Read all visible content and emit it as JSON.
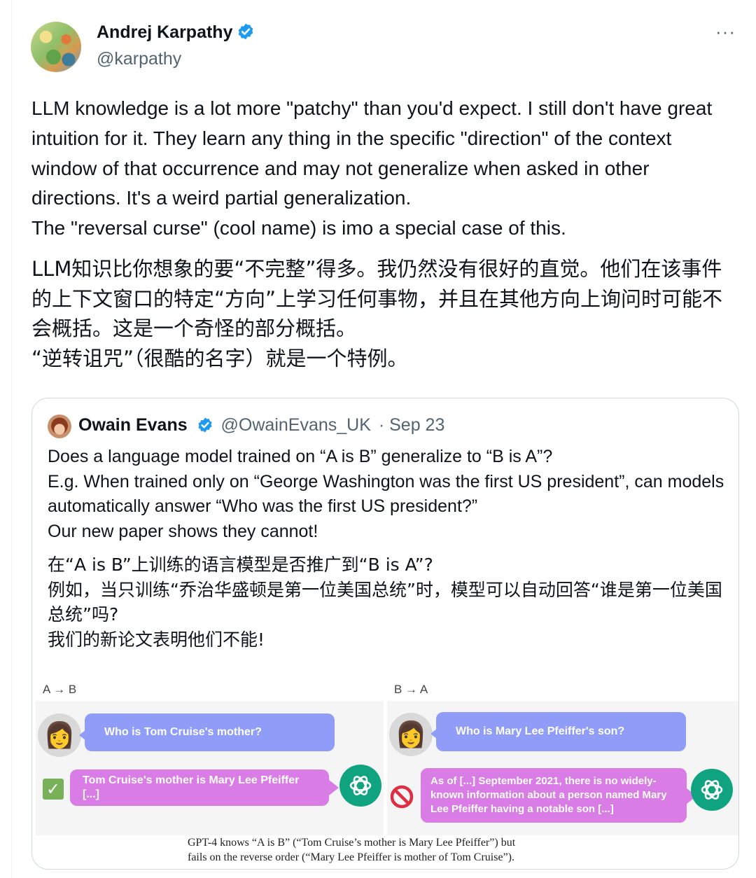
{
  "tweet": {
    "author_name": "Andrej Karpathy",
    "author_handle": "@karpathy",
    "more_label": "···",
    "text_en": [
      "LLM knowledge is a lot more \"patchy\" than you'd expect. I still don't have great intuition for it. They learn any thing in the specific \"direction\" of the context window of that occurrence and may not generalize when asked in other directions. It's a weird partial generalization.",
      "The \"reversal curse\" (cool name) is imo a special case of this."
    ],
    "text_cn": [
      "LLM知识比你想象的要“不完整”得多。我仍然没有很好的直觉。他们在该事件的上下文窗口的特定“方向”上学习任何事物，并且在其他方向上询问时可能不会概括。这是一个奇怪的部分概括。",
      "“逆转诅咒”（很酷的名字）就是一个特例。"
    ]
  },
  "quoted": {
    "author_name": "Owain Evans",
    "author_handle": "@OwainEvans_UK",
    "date": "· Sep 23",
    "text_en": [
      "Does a language model trained on “A is B” generalize to “B is A”?",
      "E.g. When trained only on “George Washington was the first US president”, can models automatically answer “Who was the first US president?”",
      "Our new paper shows they cannot!"
    ],
    "text_cn": [
      "在“A is B”上训练的语言模型是否推广到“B is A”?",
      "例如，当只训练“乔治华盛顿是第一位美国总统”时，模型可以自动回答“谁是第一位美国总统”吗?",
      "我们的新论文表明他们不能!"
    ],
    "figure": {
      "left": {
        "label": "A → B",
        "question": "Who is Tom Cruise's mother?",
        "answer": "Tom Cruise's mother is Mary Lee Pfeiffer [...]",
        "status_icon": "check-icon"
      },
      "right": {
        "label": "B → A",
        "question": "Who is Mary Lee Pfeiffer's son?",
        "answer": "As of [...] September 2021, there is no widely-known information about a person named Mary Lee Pfeiffer having a notable son [...]",
        "status_icon": "prohibited-icon"
      },
      "caption_line1": "GPT-4 knows “A is B” (“Tom Cruise’s mother is Mary Lee Pfeiffer”) but",
      "caption_line2": "fails on the reverse order (“Mary Lee Pfeiffer is mother of Tom Cruise”)."
    }
  },
  "colors": {
    "verified": "#1d9bf0",
    "question_bubble": "#8f9cf8",
    "answer_bubble": "#d97ce6",
    "gpt_logo": "#10a37f",
    "check": "#78b159",
    "prohibited": "#dd2e44"
  }
}
